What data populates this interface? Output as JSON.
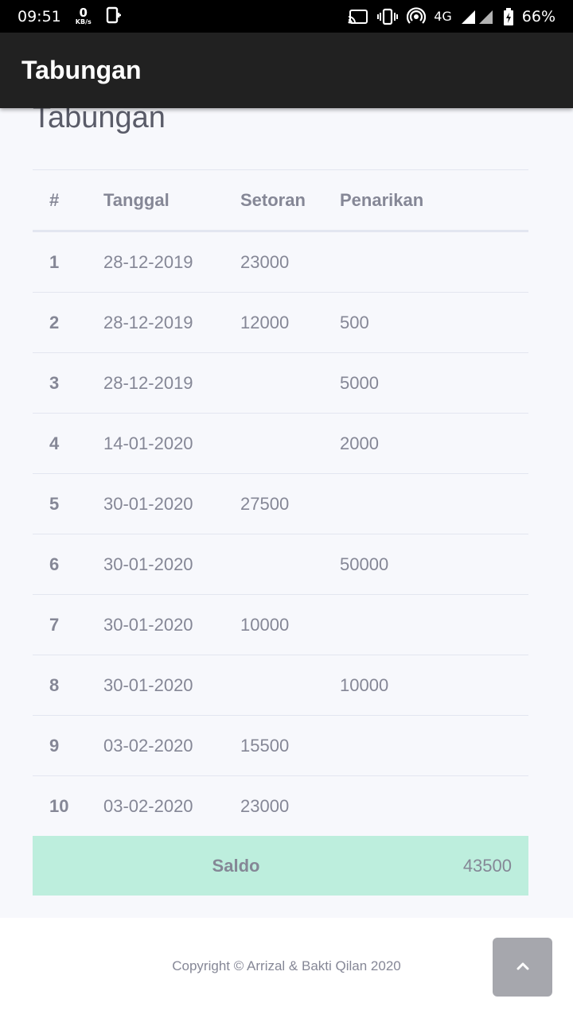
{
  "status_bar": {
    "time": "09:51",
    "speed_value": "0",
    "speed_unit": "KB/s",
    "network": "4G",
    "battery": "66%",
    "icons": [
      "download-icon",
      "cast-icon",
      "vibrate-icon",
      "hotspot-icon",
      "signal-icon",
      "battery-icon"
    ]
  },
  "app_bar": {
    "title": "Tabungan"
  },
  "page": {
    "heading": "Tabungan"
  },
  "table": {
    "headers": {
      "no": "#",
      "date": "Tanggal",
      "deposit": "Setoran",
      "withdrawal": "Penarikan"
    },
    "rows": [
      {
        "no": "1",
        "date": "28-12-2019",
        "deposit": "23000",
        "withdrawal": ""
      },
      {
        "no": "2",
        "date": "28-12-2019",
        "deposit": "12000",
        "withdrawal": "500"
      },
      {
        "no": "3",
        "date": "28-12-2019",
        "deposit": "",
        "withdrawal": "5000"
      },
      {
        "no": "4",
        "date": "14-01-2020",
        "deposit": "",
        "withdrawal": "2000"
      },
      {
        "no": "5",
        "date": "30-01-2020",
        "deposit": "27500",
        "withdrawal": ""
      },
      {
        "no": "6",
        "date": "30-01-2020",
        "deposit": "",
        "withdrawal": "50000"
      },
      {
        "no": "7",
        "date": "30-01-2020",
        "deposit": "10000",
        "withdrawal": ""
      },
      {
        "no": "8",
        "date": "30-01-2020",
        "deposit": "",
        "withdrawal": "10000"
      },
      {
        "no": "9",
        "date": "03-02-2020",
        "deposit": "15500",
        "withdrawal": ""
      },
      {
        "no": "10",
        "date": "03-02-2020",
        "deposit": "23000",
        "withdrawal": ""
      }
    ],
    "saldo_label": "Saldo",
    "saldo_value": "43500"
  },
  "footer": {
    "copyright": "Copyright © Arrizal & Bakti Qilan 2020"
  },
  "colors": {
    "app_bar": "#212121",
    "saldo_bg": "#bdeedd",
    "text": "#858796",
    "page_bg": "#f7f8fc"
  }
}
